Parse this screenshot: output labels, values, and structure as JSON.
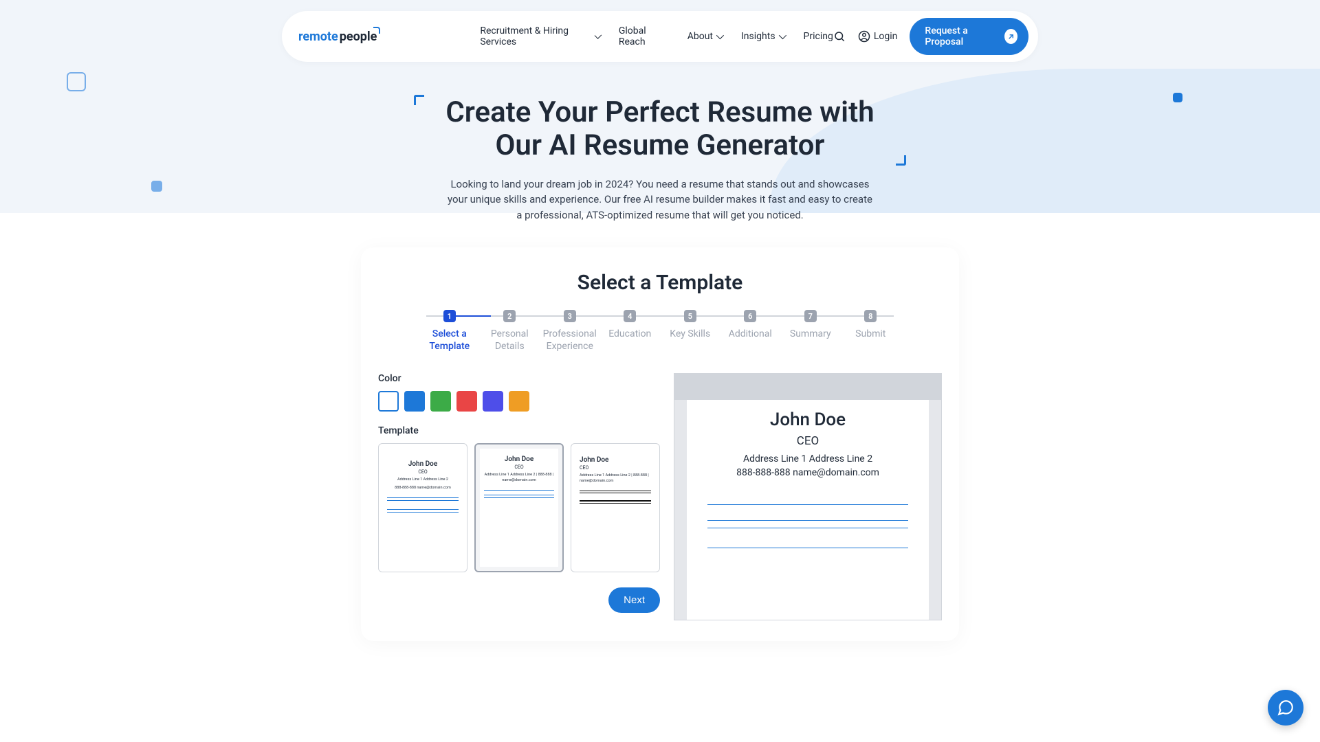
{
  "brand": {
    "part1": "remote",
    "part2": "people"
  },
  "nav": {
    "recruitment": "Recruitment & Hiring Services",
    "global": "Global Reach",
    "about": "About",
    "insights": "Insights",
    "pricing": "Pricing",
    "login": "Login",
    "cta": "Request a Proposal"
  },
  "hero": {
    "title": "Create Your Perfect Resume with Our AI Resume Generator",
    "subtitle": "Looking to land your dream job in 2024? You need a resume that stands out and showcases your unique skills and experience. Our free AI resume builder makes it fast and easy to create a professional, ATS-optimized resume that will get you noticed."
  },
  "card": {
    "title": "Select a Template",
    "steps": [
      {
        "num": "1",
        "label": "Select a Template",
        "active": true
      },
      {
        "num": "2",
        "label": "Personal Details"
      },
      {
        "num": "3",
        "label": "Professional Experience"
      },
      {
        "num": "4",
        "label": "Education"
      },
      {
        "num": "5",
        "label": "Key Skills"
      },
      {
        "num": "6",
        "label": "Additional"
      },
      {
        "num": "7",
        "label": "Summary"
      },
      {
        "num": "8",
        "label": "Submit"
      }
    ],
    "color_label": "Color",
    "colors": [
      "#ffffff",
      "#1d78d8",
      "#3cab47",
      "#e94545",
      "#4e4ee9",
      "#ef9d24"
    ],
    "template_label": "Template",
    "next": "Next"
  },
  "sample": {
    "name": "John Doe",
    "role": "CEO",
    "addr_compact": "Address Line 1 Address Line 2 | 888-888 | name@domain.com",
    "addr_line": "Address Line 1 Address Line 2",
    "contact_line": "888-888-888 name@domain.com",
    "addr_tpl1": "Address Line 1 Address Line 2\n888-888-888 name@domain.com"
  }
}
